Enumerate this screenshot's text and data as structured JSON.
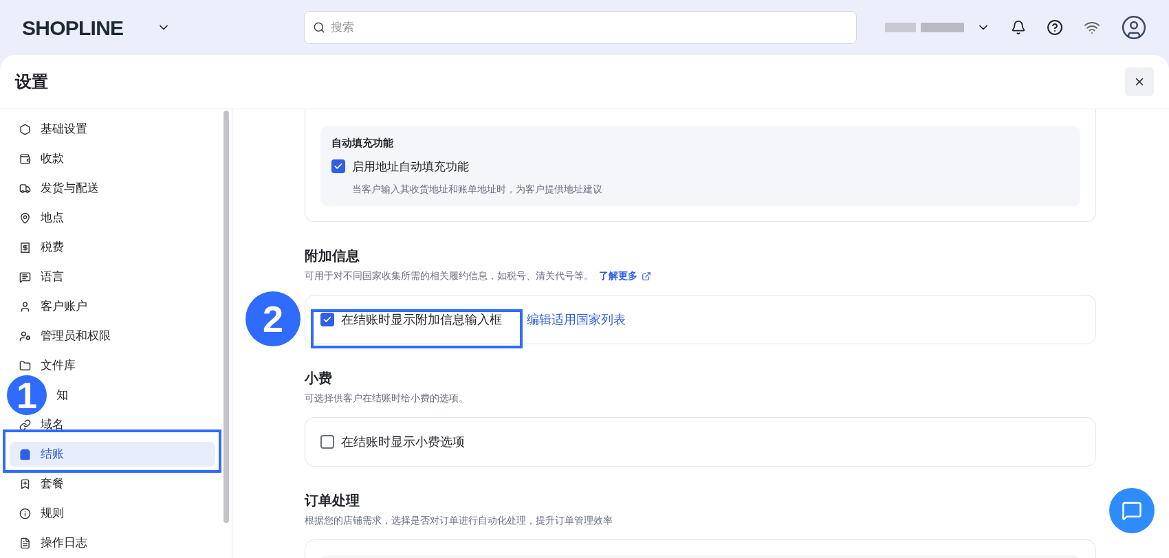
{
  "header": {
    "logo": "SHOPLINE",
    "search": {
      "placeholder": "搜索"
    }
  },
  "panel": {
    "title": "设置"
  },
  "sidebar": {
    "items": [
      {
        "label": "基础设置",
        "selected": false
      },
      {
        "label": "收款",
        "selected": false
      },
      {
        "label": "发货与配送",
        "selected": false
      },
      {
        "label": "地点",
        "selected": false
      },
      {
        "label": "税费",
        "selected": false
      },
      {
        "label": "语言",
        "selected": false
      },
      {
        "label": "客户账户",
        "selected": false
      },
      {
        "label": "管理员和权限",
        "selected": false
      },
      {
        "label": "文件库",
        "selected": false
      },
      {
        "label": "知",
        "selected": false,
        "kind": "covered"
      },
      {
        "label": "域名",
        "selected": false
      },
      {
        "label": "结账",
        "selected": true
      },
      {
        "label": "套餐",
        "selected": false
      },
      {
        "label": "规则",
        "selected": false
      },
      {
        "label": "操作日志",
        "selected": false
      }
    ]
  },
  "autofill": {
    "title": "自动填充功能",
    "option": {
      "label": "启用地址自动填充功能",
      "checked": true,
      "description": "当客户输入其收货地址和账单地址时，为客户提供地址建议"
    }
  },
  "sections": [
    {
      "title": "附加信息",
      "description": "可用于对不同国家收集所需的相关履约信息，如税号、清关代号等。",
      "link": "了解更多",
      "option": {
        "label": "在结账时显示附加信息输入框",
        "checked": true
      },
      "action": "编辑适用国家列表"
    },
    {
      "title": "小费",
      "description": "可选择供客户在结账时给小费的选项。",
      "option": {
        "label": "在结账时显示小费选项",
        "checked": false
      }
    },
    {
      "title": "订单处理",
      "description": "根据您的店铺需求，选择是否对订单进行自动化处理，提升订单管理效率"
    }
  ],
  "annotations": [
    {
      "label": "1"
    },
    {
      "label": "2"
    }
  ]
}
